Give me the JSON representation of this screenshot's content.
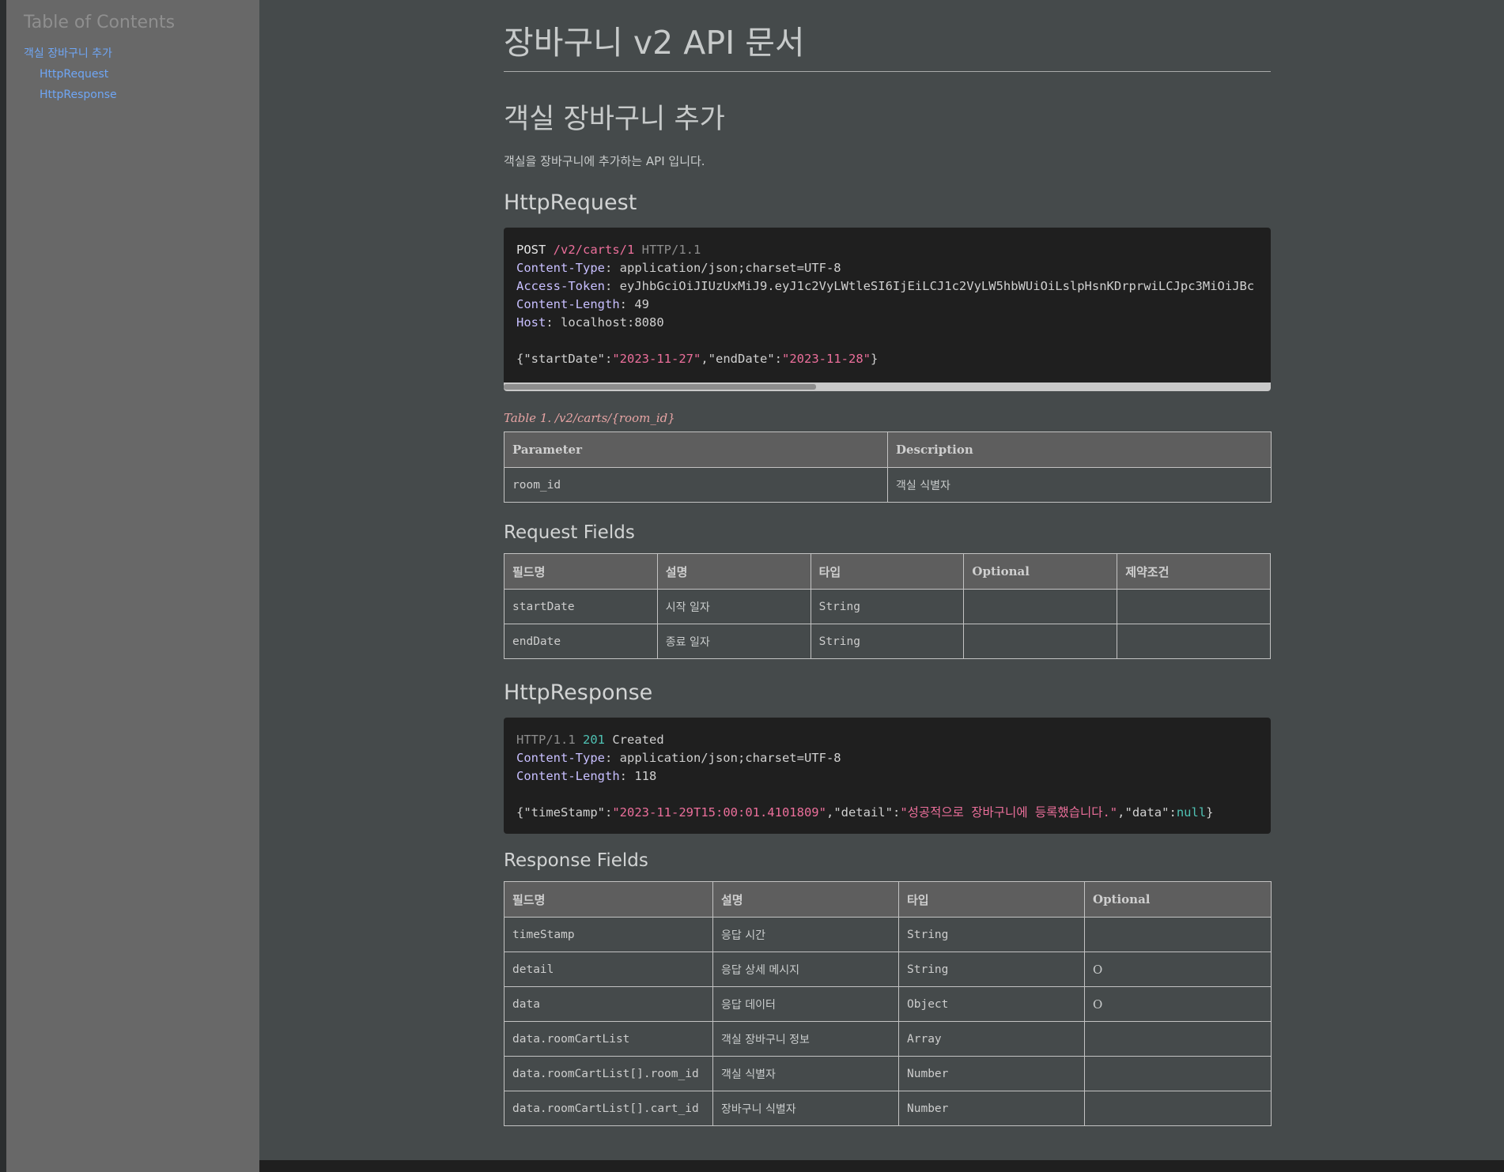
{
  "toc": {
    "title": "Table of Contents",
    "items": [
      {
        "label": "객실 장바구니 추가"
      },
      {
        "label": "HttpRequest"
      },
      {
        "label": "HttpResponse"
      }
    ]
  },
  "doc": {
    "title": "장바구니 v2 API 문서",
    "section_title": "객실 장바구니 추가",
    "intro": "객실을 장바구니에 추가하는 API 입니다."
  },
  "request": {
    "heading": "HttpRequest",
    "method": "POST",
    "path": "/v2/carts/1",
    "protocol": "HTTP/1.1",
    "headers": [
      {
        "name": "Content-Type",
        "value": "application/json;charset=UTF-8"
      },
      {
        "name": "Access-Token",
        "value": "eyJhbGciOiJIUzUxMiJ9.eyJ1c2VyLWtleSI6IjEiLCJ1c2VyLW5hbWUiOiLslpHsnKDrprwiLCJpc3MiOiJBc"
      },
      {
        "name": "Content-Length",
        "value": "49"
      },
      {
        "name": "Host",
        "value": "localhost:8080"
      }
    ],
    "body": {
      "open": "{",
      "k1": "\"startDate\"",
      "v1": "\"2023-11-27\"",
      "k2": "\"endDate\"",
      "v2": "\"2023-11-28\"",
      "close": "}"
    }
  },
  "path_params": {
    "caption": "Table 1. /v2/carts/{room_id}",
    "columns": [
      "Parameter",
      "Description"
    ],
    "rows": [
      {
        "name": "room_id",
        "description": "객실 식별자"
      }
    ]
  },
  "request_fields": {
    "heading": "Request Fields",
    "columns": [
      "필드명",
      "설명",
      "타입",
      "Optional",
      "제약조건"
    ],
    "rows": [
      {
        "field": "startDate",
        "desc": "시작 일자",
        "type": "String",
        "optional": "",
        "constraint": ""
      },
      {
        "field": "endDate",
        "desc": "종료 일자",
        "type": "String",
        "optional": "",
        "constraint": ""
      }
    ]
  },
  "response": {
    "heading": "HttpResponse",
    "protocol": "HTTP/1.1",
    "status_code": "201",
    "status_text": "Created",
    "headers": [
      {
        "name": "Content-Type",
        "value": "application/json;charset=UTF-8"
      },
      {
        "name": "Content-Length",
        "value": "118"
      }
    ],
    "body": {
      "open": "{",
      "k1": "\"timeStamp\"",
      "v1": "\"2023-11-29T15:00:01.4101809\"",
      "k2": "\"detail\"",
      "v2": "\"성공적으로 장바구니에 등록했습니다.\"",
      "k3": "\"data\"",
      "v3": "null",
      "close": "}"
    }
  },
  "response_fields": {
    "heading": "Response Fields",
    "columns": [
      "필드명",
      "설명",
      "타입",
      "Optional"
    ],
    "rows": [
      {
        "field": "timeStamp",
        "desc": "응답 시간",
        "type": "String",
        "optional": ""
      },
      {
        "field": "detail",
        "desc": "응답 상세 메시지",
        "type": "String",
        "optional": "O"
      },
      {
        "field": "data",
        "desc": "응답 데이터",
        "type": "Object",
        "optional": "O"
      },
      {
        "field": "data.roomCartList",
        "desc": "객실 장바구니 정보",
        "type": "Array",
        "optional": ""
      },
      {
        "field": "data.roomCartList[].room_id",
        "desc": "객실 식별자",
        "type": "Number",
        "optional": ""
      },
      {
        "field": "data.roomCartList[].cart_id",
        "desc": "장바구니 식별자",
        "type": "Number",
        "optional": ""
      }
    ]
  }
}
